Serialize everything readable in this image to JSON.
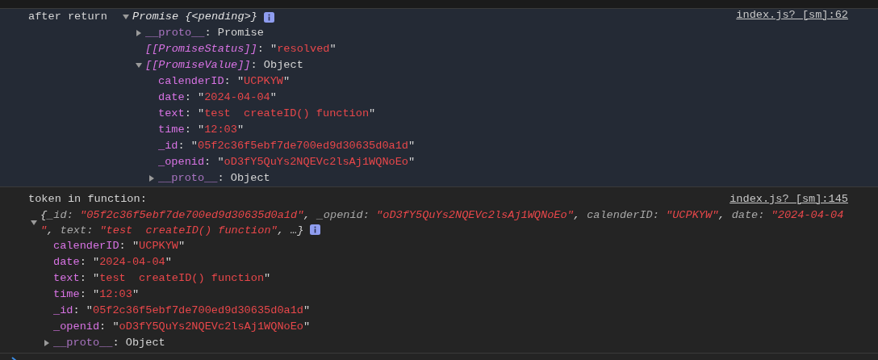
{
  "console": {
    "entries": [
      {
        "kind": "inline",
        "highlighted": true,
        "label": "after return",
        "source": "index.js? [sm]:62",
        "root": {
          "kind": "text",
          "text": "Promise {<pending>}",
          "info_badge": true,
          "expanded": true,
          "children": [
            {
              "key": "__proto__:",
              "kind": "proto",
              "value": "Promise",
              "expanded": false
            },
            {
              "key": "[[PromiseStatus]]:",
              "kind": "internal",
              "string": "\"resolved\""
            },
            {
              "key": "[[PromiseValue]]:",
              "kind": "internal",
              "value": "Object",
              "expanded": true,
              "children": [
                {
                  "key": "calenderID:",
                  "kind": "prop",
                  "string": "\"UCPKYW\""
                },
                {
                  "key": "date:",
                  "kind": "prop",
                  "string": "\"2024-04-04\""
                },
                {
                  "key": "text:",
                  "kind": "prop",
                  "string": "\"test  createID() function\""
                },
                {
                  "key": "time:",
                  "kind": "prop",
                  "string": "\"12:03\""
                },
                {
                  "key": "_id:",
                  "kind": "prop",
                  "string": "\"05f2c36f5ebf7de700ed9d30635d0a1d\""
                },
                {
                  "key": "_openid:",
                  "kind": "prop",
                  "string": "\"oD3fY5QuYs2NQEVc2lsAj1WQNoEo\""
                },
                {
                  "key": "__proto__:",
                  "kind": "proto",
                  "value": "Object",
                  "expanded": false
                }
              ]
            }
          ]
        }
      },
      {
        "kind": "stacked",
        "highlighted": false,
        "label": "token in function:",
        "source": "index.js? [sm]:145",
        "root": {
          "kind": "preview",
          "info_badge": true,
          "expanded": true,
          "preview": [
            {
              "kind": "punct",
              "text": "{"
            },
            {
              "kind": "key",
              "text": "_id: "
            },
            {
              "kind": "string",
              "text": "\"05f2c36f5ebf7de700ed9d30635d0a1d\""
            },
            {
              "kind": "punct",
              "text": ", "
            },
            {
              "kind": "key",
              "text": "_openid: "
            },
            {
              "kind": "string",
              "text": "\"oD3fY5QuYs2NQEVc2lsAj1WQNoEo\""
            },
            {
              "kind": "punct",
              "text": ", "
            },
            {
              "kind": "key",
              "text": "calenderID: "
            },
            {
              "kind": "string",
              "text": "\"UCPKYW\""
            },
            {
              "kind": "punct",
              "text": ", "
            },
            {
              "kind": "key",
              "text": "date: "
            },
            {
              "kind": "string",
              "text": "\"2024-04-04\""
            },
            {
              "kind": "punct",
              "text": ", "
            },
            {
              "kind": "key",
              "text": "text: "
            },
            {
              "kind": "string",
              "text": "\"test  createID() function\""
            },
            {
              "kind": "punct",
              "text": ", …}"
            }
          ],
          "children": [
            {
              "key": "calenderID:",
              "kind": "prop",
              "string": "\"UCPKYW\""
            },
            {
              "key": "date:",
              "kind": "prop",
              "string": "\"2024-04-04\""
            },
            {
              "key": "text:",
              "kind": "prop",
              "string": "\"test  createID() function\""
            },
            {
              "key": "time:",
              "kind": "prop",
              "string": "\"12:03\""
            },
            {
              "key": "_id:",
              "kind": "prop",
              "string": "\"05f2c36f5ebf7de700ed9d30635d0a1d\""
            },
            {
              "key": "_openid:",
              "kind": "prop",
              "string": "\"oD3fY5QuYs2NQEVc2lsAj1WQNoEo\""
            },
            {
              "key": "__proto__:",
              "kind": "proto",
              "value": "Object",
              "expanded": false
            }
          ]
        }
      }
    ]
  }
}
